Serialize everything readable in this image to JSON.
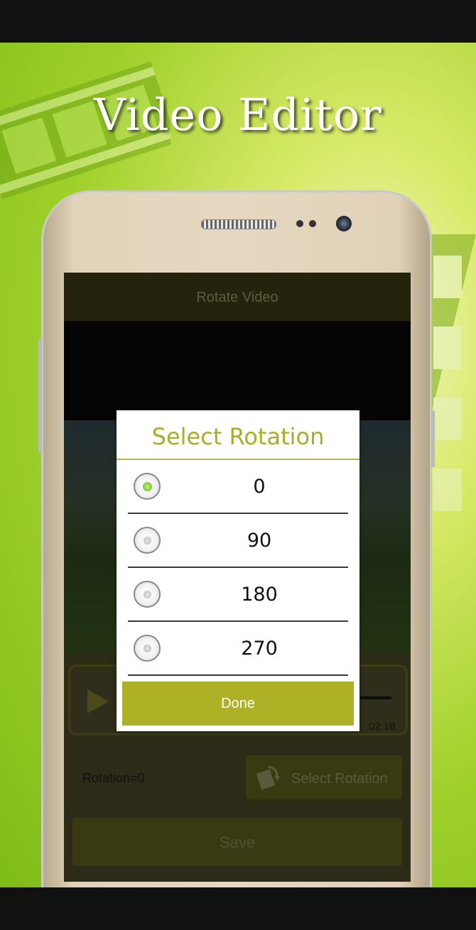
{
  "promo": {
    "title": "Video Editor"
  },
  "app": {
    "appbar_title": "Rotate Video",
    "player": {
      "time": "02:18"
    },
    "rotation_status": "Rotation=0",
    "select_rotation_label": "Select Rotation",
    "save_label": "Save"
  },
  "dialog": {
    "title": "Select Rotation",
    "options": [
      {
        "label": "0",
        "checked": true
      },
      {
        "label": "90",
        "checked": false
      },
      {
        "label": "180",
        "checked": false
      },
      {
        "label": "270",
        "checked": false
      }
    ],
    "done_label": "Done"
  },
  "colors": {
    "accent": "#aeb026",
    "dialog_title": "#a9ad28",
    "background_green": "#9fd02a"
  }
}
